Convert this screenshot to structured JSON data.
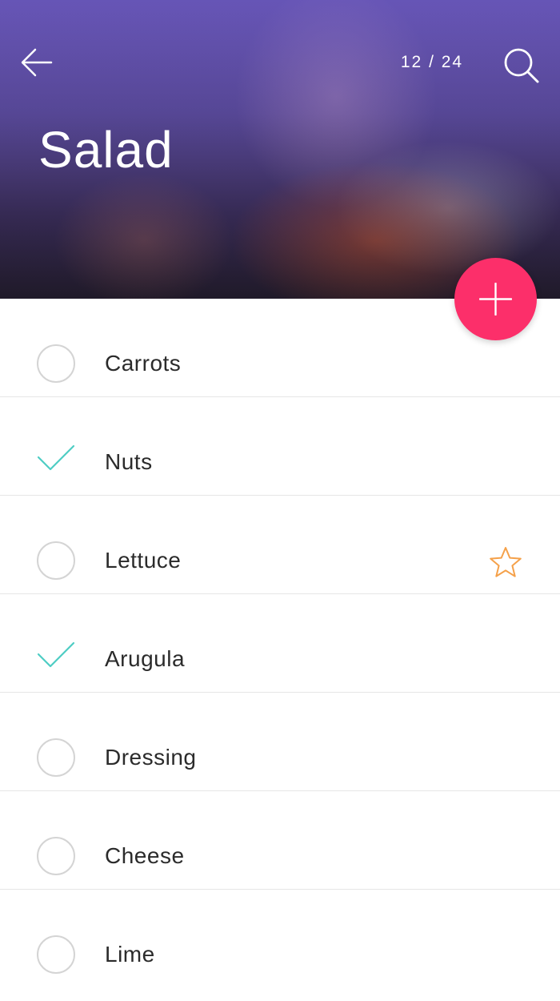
{
  "header": {
    "title": "Salad",
    "counter": "12 / 24",
    "back_icon": "arrow-left-icon",
    "search_icon": "search-icon",
    "add_icon": "plus-icon"
  },
  "colors": {
    "accent": "#FC2F6A",
    "check": "#4ECDC4",
    "star": "#F5A14A"
  },
  "items": [
    {
      "label": "Carrots",
      "checked": false,
      "starred": false
    },
    {
      "label": "Nuts",
      "checked": true,
      "starred": false
    },
    {
      "label": "Lettuce",
      "checked": false,
      "starred": true
    },
    {
      "label": "Arugula",
      "checked": true,
      "starred": false
    },
    {
      "label": "Dressing",
      "checked": false,
      "starred": false
    },
    {
      "label": "Cheese",
      "checked": false,
      "starred": false
    },
    {
      "label": "Lime",
      "checked": false,
      "starred": false
    }
  ]
}
